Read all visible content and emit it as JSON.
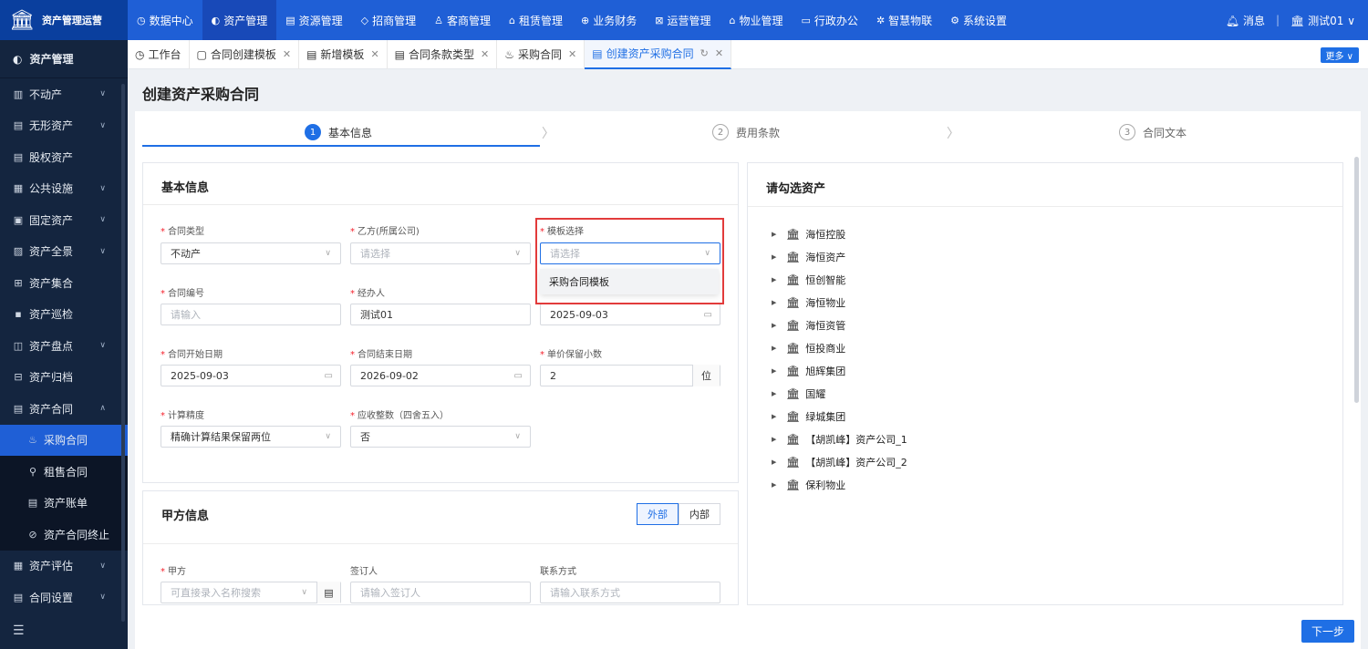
{
  "app": {
    "logo_icon": "bank-icon",
    "title": "资产管理运营"
  },
  "nav": [
    {
      "icon": "◷",
      "label": "数据中心"
    },
    {
      "icon": "◐",
      "label": "资产管理",
      "active": true
    },
    {
      "icon": "▤",
      "label": "资源管理"
    },
    {
      "icon": "◇",
      "label": "招商管理"
    },
    {
      "icon": "♙",
      "label": "客商管理"
    },
    {
      "icon": "⌂",
      "label": "租赁管理"
    },
    {
      "icon": "⊕",
      "label": "业务财务"
    },
    {
      "icon": "⊠",
      "label": "运营管理"
    },
    {
      "icon": "⌂",
      "label": "物业管理"
    },
    {
      "icon": "▭",
      "label": "行政办公"
    },
    {
      "icon": "✲",
      "label": "智慧物联"
    },
    {
      "icon": "⚙",
      "label": "系统设置"
    }
  ],
  "topright": {
    "msg": "消息",
    "sep": "|",
    "user": "测试01"
  },
  "sidebar": {
    "head": "资产管理",
    "items": [
      {
        "icon": "▥",
        "label": "不动产",
        "chev": "∨"
      },
      {
        "icon": "▤",
        "label": "无形资产",
        "chev": "∨"
      },
      {
        "icon": "▤",
        "label": "股权资产",
        "chev": ""
      },
      {
        "icon": "▦",
        "label": "公共设施",
        "chev": "∨"
      },
      {
        "icon": "▣",
        "label": "固定资产",
        "chev": "∨"
      },
      {
        "icon": "▨",
        "label": "资产全景",
        "chev": "∨"
      },
      {
        "icon": "⊞",
        "label": "资产集合",
        "chev": ""
      },
      {
        "icon": "▪",
        "label": "资产巡检",
        "chev": ""
      },
      {
        "icon": "◫",
        "label": "资产盘点",
        "chev": "∨"
      },
      {
        "icon": "⊟",
        "label": "资产归档",
        "chev": ""
      },
      {
        "icon": "▤",
        "label": "资产合同",
        "chev": "∧"
      }
    ],
    "subs": [
      {
        "icon": "♨",
        "label": "采购合同",
        "active": true
      },
      {
        "icon": "⚲",
        "label": "租售合同"
      },
      {
        "icon": "▤",
        "label": "资产账单"
      },
      {
        "icon": "⊘",
        "label": "资产合同终止"
      }
    ],
    "items2": [
      {
        "icon": "▦",
        "label": "资产评估",
        "chev": "∨"
      },
      {
        "icon": "▤",
        "label": "合同设置",
        "chev": "∨"
      }
    ],
    "foot": "☰"
  },
  "tabs": [
    {
      "icon": "◷",
      "label": "工作台",
      "close": ""
    },
    {
      "icon": "▢",
      "label": "合同创建模板",
      "close": "✕"
    },
    {
      "icon": "▤",
      "label": "新增模板",
      "close": "✕"
    },
    {
      "icon": "▤",
      "label": "合同条款类型",
      "close": "✕"
    },
    {
      "icon": "♨",
      "label": "采购合同",
      "close": "✕"
    },
    {
      "icon": "▤",
      "label": "创建资产采购合同",
      "close": "✕",
      "active": true,
      "refresh": "↻"
    }
  ],
  "more": "更多 ∨",
  "page_title": "创建资产采购合同",
  "steps": [
    {
      "num": "1",
      "label": "基本信息"
    },
    {
      "num": "2",
      "label": "费用条款"
    },
    {
      "num": "3",
      "label": "合同文本"
    }
  ],
  "basic": {
    "title": "基本信息",
    "f_type": {
      "label": "合同类型",
      "value": "不动产"
    },
    "f_party": {
      "label": "乙方(所属公司)",
      "placeholder": "请选择"
    },
    "f_tpl": {
      "label": "模板选择",
      "placeholder": "请选择"
    },
    "tpl_option": "采购合同模板",
    "f_no": {
      "label": "合同编号",
      "placeholder": "请输入"
    },
    "f_handler": {
      "label": "经办人",
      "value": "测试01"
    },
    "f_date": {
      "value": "2025-09-03"
    },
    "f_start": {
      "label": "合同开始日期",
      "value": "2025-09-03"
    },
    "f_end": {
      "label": "合同结束日期",
      "value": "2026-09-02"
    },
    "f_decimal": {
      "label": "单价保留小数",
      "value": "2",
      "unit": "位"
    },
    "f_precision": {
      "label": "计算精度",
      "value": "精确计算结果保留两位"
    },
    "f_round": {
      "label": "应收整数（四舍五入）",
      "value": "否"
    }
  },
  "partyA": {
    "title": "甲方信息",
    "seg_out": "外部",
    "seg_in": "内部",
    "f_a": {
      "label": "甲方",
      "placeholder": "可直接录入名称搜索"
    },
    "f_signer": {
      "label": "签订人",
      "placeholder": "请输入签订人"
    },
    "f_contact": {
      "label": "联系方式",
      "placeholder": "请输入联系方式"
    }
  },
  "assets": {
    "title": "请勾选资产",
    "items": [
      "海恒控股",
      "海恒资产",
      "恒创智能",
      "海恒物业",
      "海恒资管",
      "恒投商业",
      "旭辉集团",
      "国耀",
      "绿城集团",
      "【胡凯峰】资产公司_1",
      "【胡凯峰】资产公司_2",
      "保利物业"
    ]
  },
  "next": "下一步"
}
